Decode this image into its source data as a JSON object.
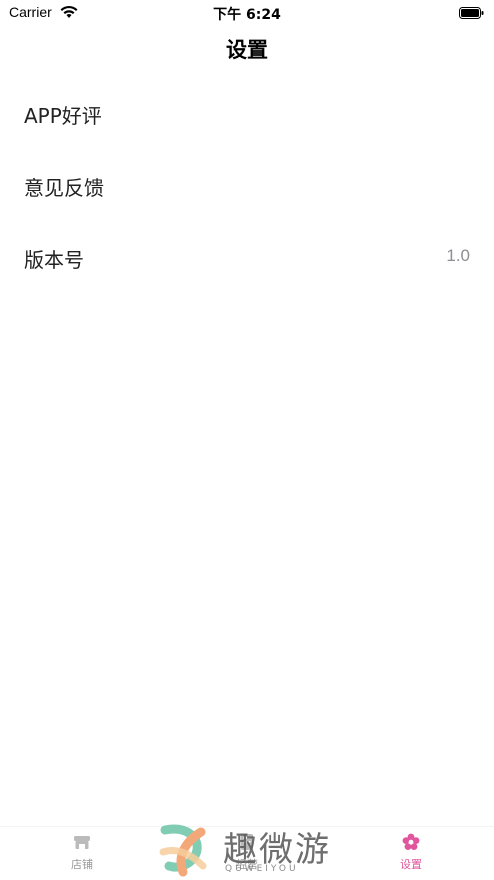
{
  "status_bar": {
    "carrier": "Carrier",
    "time": "下午 6:24"
  },
  "nav": {
    "title": "设置"
  },
  "settings_list": [
    {
      "label": "APP好评",
      "value": ""
    },
    {
      "label": "意见反馈",
      "value": ""
    },
    {
      "label": "版本号",
      "value": "1.0"
    }
  ],
  "tab_bar": {
    "items": [
      {
        "label": "店铺",
        "icon": "store-icon",
        "active": false
      },
      {
        "label": "经营",
        "icon": "ledger-icon",
        "active": false
      },
      {
        "label": "设置",
        "icon": "flower-gear-icon",
        "active": true
      }
    ],
    "active_color": "#e0559b",
    "inactive_color": "#999999"
  },
  "watermark": {
    "text": "趣微游",
    "sub": "QUWEIYOU"
  }
}
